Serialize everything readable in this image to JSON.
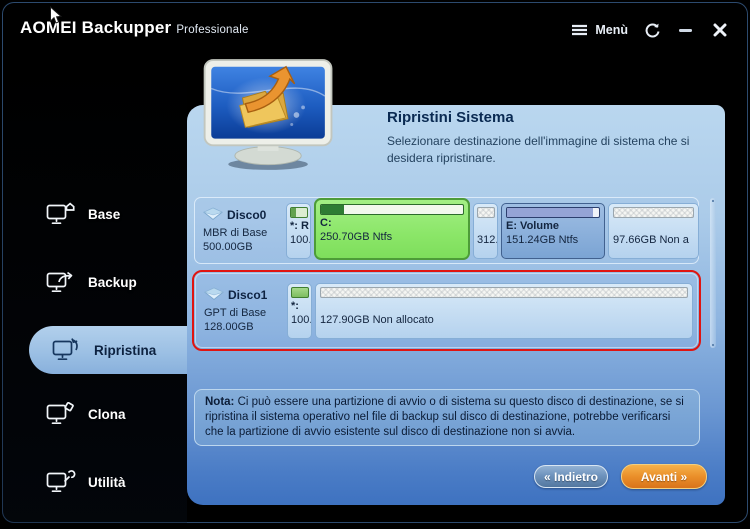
{
  "titlebar": {
    "app_name": "AOMEI Backupper",
    "edition": "Professionale",
    "menu_label": "Menù"
  },
  "sidebar": {
    "items": [
      {
        "label": "Base",
        "selected": false
      },
      {
        "label": "Backup",
        "selected": false
      },
      {
        "label": "Ripristina",
        "selected": true
      },
      {
        "label": "Clona",
        "selected": false
      },
      {
        "label": "Utilità",
        "selected": false
      }
    ]
  },
  "header": {
    "title": "Ripristini Sistema",
    "subtitle": "Selezionare destinazione dell'immagine di sistema che si desidera ripristinare."
  },
  "disks": [
    {
      "name": "Disco0",
      "type": "MBR di Base",
      "size": "500.00GB",
      "highlighted": false,
      "partitions": [
        {
          "label": "*: R",
          "detail": "100.",
          "state": "system-reserved"
        },
        {
          "label": "C:",
          "detail": "250.70GB Ntfs",
          "state": "selected"
        },
        {
          "label": "",
          "detail": "312.",
          "state": "unallocated"
        },
        {
          "label": "E: Volume",
          "detail": "151.24GB Ntfs",
          "state": "ntfs"
        },
        {
          "label": "",
          "detail": "97.66GB Non a",
          "state": "unallocated"
        }
      ]
    },
    {
      "name": "Disco1",
      "type": "GPT di Base",
      "size": "128.00GB",
      "highlighted": true,
      "partitions": [
        {
          "label": "*:",
          "detail": "100.",
          "state": "efi"
        },
        {
          "label": "",
          "detail": "127.90GB Non allocato",
          "state": "unallocated"
        }
      ]
    }
  ],
  "note": {
    "label": "Nota:",
    "text": " Ci può essere una partizione di avvio o di sistema su questo disco di destinazione, se si ripristina il sistema operativo nel file di backup sul disco di destinazione, potrebbe verificarsi che la partizione di avvio esistente sul disco di destinazione non si avvia."
  },
  "footer": {
    "back_label": "« Indietro",
    "next_label": "Avanti »"
  },
  "colors": {
    "highlight_border": "#e01410",
    "selected_partition_green": "#8be668",
    "ntfs_partition_blue": "#7ba4d4",
    "next_button_orange": "#ea8f2a",
    "back_button_blue": "#6e93bd",
    "panel_top": "#bad7ef",
    "panel_bottom": "#3e72c0",
    "selected_nav_pill": "#9cc0e4"
  }
}
